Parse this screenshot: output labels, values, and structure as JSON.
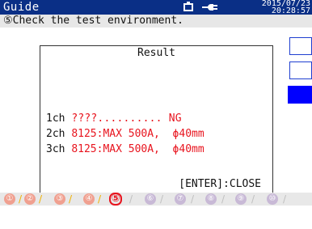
{
  "titlebar": {
    "title": "Guide",
    "date": "2015/07/23",
    "time": "20:28:57",
    "battery_icon": "battery-icon",
    "power_icon": "ac-power-plug-icon"
  },
  "instruction": "⑤Check the test environment.",
  "dialog": {
    "title": "Result",
    "rows": [
      {
        "channel": "1ch",
        "result": "????..........",
        "status": " NG"
      },
      {
        "channel": "2ch",
        "result": "8125:MAX 500A,  ϕ40mm",
        "status": ""
      },
      {
        "channel": "3ch",
        "result": "8125:MAX 500A,  ϕ40mm",
        "status": ""
      }
    ],
    "close_hint": "[ENTER]:CLOSE"
  },
  "steps": [
    "①",
    "②",
    "③",
    "④",
    "⑤",
    "⑥",
    "⑦",
    "⑧",
    "⑨",
    "⑩"
  ],
  "current_step": 5,
  "colors": {
    "titlebar": "#0a2f86",
    "result_text": "#e8141e",
    "step_done": "#f0a090",
    "step_todo": "#c8b9d6",
    "current_step": "#e8141e",
    "accent_blue": "#0000ff"
  }
}
